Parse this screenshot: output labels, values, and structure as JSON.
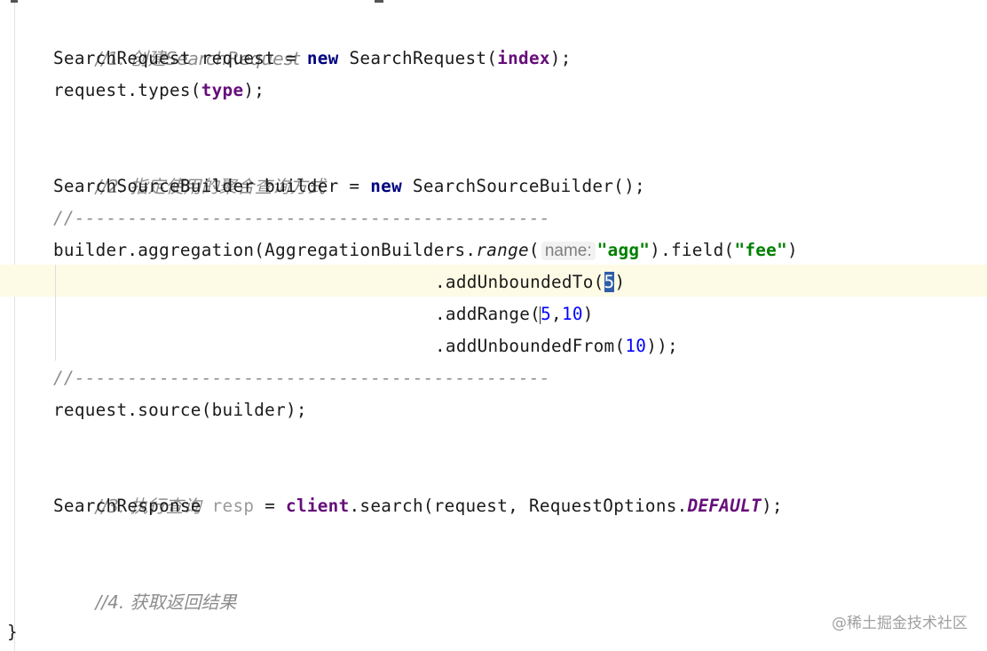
{
  "editor": {
    "comment_1": "//1. 创建SearchRequest",
    "line_2": {
      "type": "SearchRequest",
      "var": "request",
      "op": "=",
      "kw": "new",
      "ctor": "SearchRequest(",
      "arg": "index",
      "end": ");"
    },
    "line_3": {
      "call": "request.types(",
      "arg": "type",
      "end": ");"
    },
    "comment_2": "//2. 指定使用的聚合查询方式",
    "line_5": {
      "decl": "SearchSourceBuilder builder = ",
      "kw": "new",
      "rest": "SearchSourceBuilder();"
    },
    "divider_1": "//---------------------------------------------",
    "line_7": {
      "start": "builder.aggregation(AggregationBuilders.",
      "method": "range",
      "paren": "(",
      "hint": "name:",
      "str1": "\"agg\"",
      "mid": ").field(",
      "str2": "\"fee\"",
      "end": ")"
    },
    "line_8": {
      "call": ".addUnboundedTo(",
      "num": "5",
      "end": ")"
    },
    "line_9": {
      "call": ".addRange(",
      "num1": "5",
      "comma": ",",
      "num2": "10",
      "end": ")"
    },
    "line_10": {
      "call": ".addUnboundedFrom(",
      "num": "10",
      "end": "));"
    },
    "divider_2": "//---------------------------------------------",
    "line_12": "request.source(builder);",
    "comment_3": "//3. 执行查询",
    "line_14": {
      "type": "SearchResponse",
      "var": "resp",
      "op": "=",
      "field": "client",
      "call": ".search(request, RequestOptions.",
      "const": "DEFAULT",
      "end": ");"
    },
    "comment_4": "//4. 获取返回结果",
    "closing_brace": "}"
  },
  "watermark": "@稀土掘金技术社区",
  "colors": {
    "keyword": "#000080",
    "field": "#660e7a",
    "number": "#0000ff",
    "string": "#008000",
    "comment": "#8c8c8c",
    "caret_row": "#fdfbe5",
    "selection": "#2f5ea9"
  }
}
